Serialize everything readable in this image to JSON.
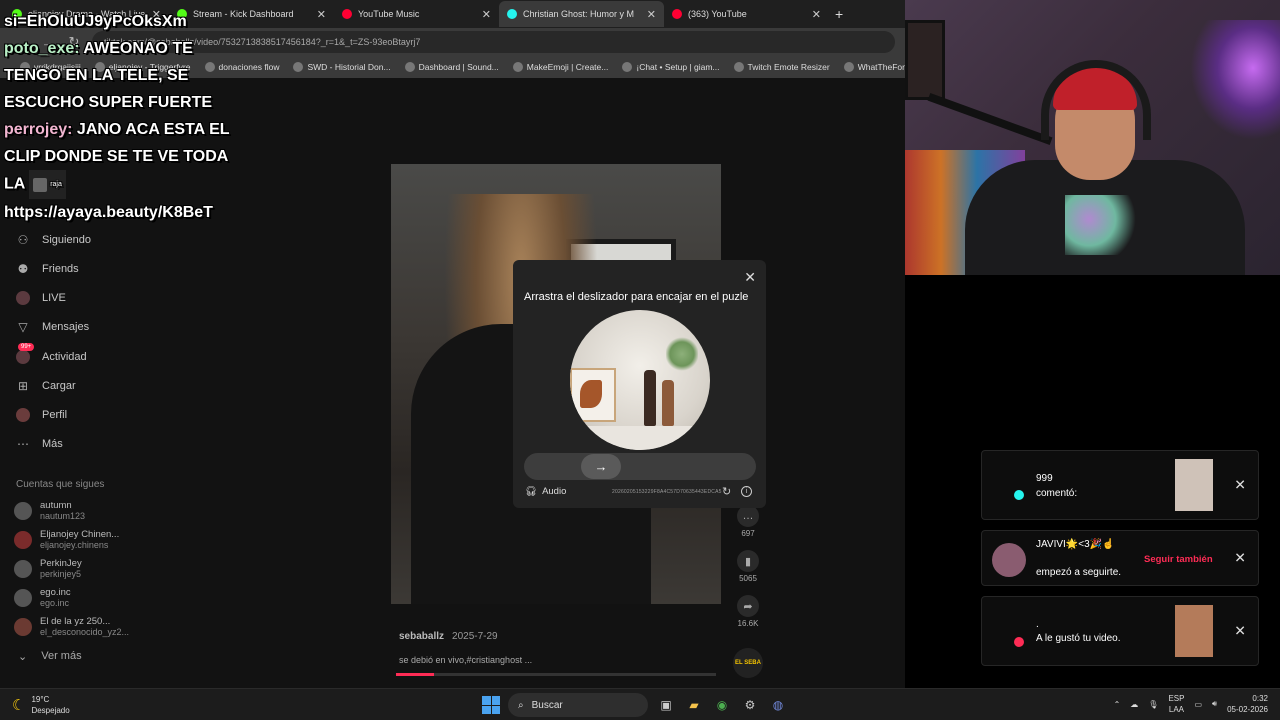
{
  "browser": {
    "tabs": [
      {
        "label": "eljanojey Drama - Watch Live",
        "color": "#53fc18",
        "active": false
      },
      {
        "label": "Stream - Kick Dashboard",
        "color": "#53fc18",
        "active": false
      },
      {
        "label": "YouTube Music",
        "color": "#ff0033",
        "active": false
      },
      {
        "label": "Christian Ghost: Humor y M",
        "color": "#25f4ee",
        "active": true
      },
      {
        "label": "(363) YouTube",
        "color": "#ff0033",
        "active": false
      }
    ],
    "new_tab": "+",
    "url": "tiktok.com/@sebaballz/video/7532713838517456184?_r=1&_t=ZS-93eoBtayrj7",
    "bookmarks": [
      "vrrjkdrgajjsjjj",
      "eljanojey - Triggerfyre",
      "donaciones flow",
      "SWD - Historial Don...",
      "Dashboard | Sound...",
      "MakeEmoji | Create...",
      "¡Chat • Setup | giam...",
      "Twitch Emote Resizer",
      "WhatTheFont Font I..."
    ]
  },
  "chat": [
    {
      "user": "",
      "text": "si=EhOluUJ9yPcOksXm"
    },
    {
      "user": "poto_exe:",
      "text": " AWEONAO TE TENGO EN LA TELE, SE ESCUCHO SUPER FUERTE"
    },
    {
      "user": "perrojey:",
      "text": " JANO ACA ESTA EL CLIP DONDE SE TE VE TODA LA "
    },
    {
      "user": "",
      "text": "https://ayaya.beauty/K8BeT"
    }
  ],
  "chat_emote": "raja",
  "sidebar": {
    "items": [
      {
        "label": "Siguiendo",
        "icon": "following-icon"
      },
      {
        "label": "Friends",
        "icon": "friends-icon"
      },
      {
        "label": "LIVE",
        "icon": "live-icon"
      },
      {
        "label": "Mensajes",
        "icon": "messages-icon"
      },
      {
        "label": "Actividad",
        "icon": "activity-icon"
      },
      {
        "label": "Cargar",
        "icon": "upload-icon"
      },
      {
        "label": "Perfil",
        "icon": "profile-icon"
      },
      {
        "label": "Más",
        "icon": "more-icon"
      }
    ],
    "activity_badge": "99+",
    "following_header": "Cuentas que sigues",
    "accounts": [
      {
        "name": "autumn",
        "handle": "nautum123"
      },
      {
        "name": "Eljanojey Chinen...",
        "handle": "eljanojey.chinens"
      },
      {
        "name": "PerkinJey",
        "handle": "perkinjey5"
      },
      {
        "name": "ego.inc",
        "handle": "ego.inc"
      },
      {
        "name": "El de la yz 250...",
        "handle": "el_desconocido_yz2..."
      }
    ],
    "see_more": "Ver más"
  },
  "video": {
    "author": "sebaballz",
    "date": "2025-7-29",
    "description": "se debió en vivo,#cristianghost ...",
    "progress_fraction": 0.12,
    "counts": [
      "697",
      "5065",
      "16.6K"
    ],
    "disc_label": "EL SEBA"
  },
  "captcha": {
    "title": "Arrastra el deslizador para encajar en el puzle",
    "audio_label": "Audio",
    "code": "20260205153229F8A4C57D70635443EDCA5",
    "slider_position": 0.25
  },
  "notifications": [
    {
      "line1": "999",
      "line2": "comentó:",
      "dot_color": "#25f4ee"
    },
    {
      "line1": "JAVIVI🌟<3🎉☝",
      "line2": "empezó a seguirte.",
      "follow_label": "Seguir también"
    },
    {
      "line1": ".",
      "line2": "A le gustó tu video.",
      "dot_color": "#fe2c55"
    }
  ],
  "taskbar": {
    "weather_temp": "19°C",
    "weather_desc": "Despejado",
    "search_placeholder": "Buscar",
    "lang_line1": "ESP",
    "lang_line2": "LAA",
    "time": "0:32",
    "date": "05-02-2026"
  }
}
